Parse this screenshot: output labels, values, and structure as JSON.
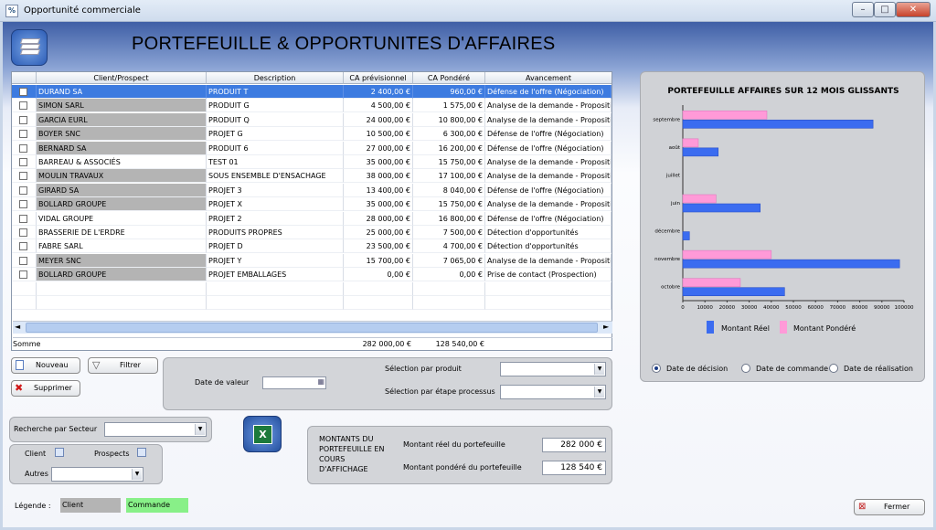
{
  "window": {
    "title": "Opportunité commerciale",
    "icon_text": "%",
    "min": "–",
    "max": "□",
    "close": "✕"
  },
  "page_title": "PORTEFEUILLE & OPPORTUNITES D'AFFAIRES",
  "grid": {
    "columns": [
      "Client/Prospect",
      "Description",
      "CA prévisionnel",
      "CA Pondéré",
      "Avancement"
    ],
    "rows": [
      {
        "client": "DURAND SA",
        "description": "PRODUIT T",
        "ca_prev": "2 400,00 €",
        "ca_pond": "960,00 €",
        "avancement": "Défense de l'offre (Négociation)"
      },
      {
        "client": "SIMON SARL",
        "description": "PRODUIT G",
        "ca_prev": "4 500,00 €",
        "ca_pond": "1 575,00 €",
        "avancement": "Analyse de la demande - Propositions"
      },
      {
        "client": "GARCIA EURL",
        "description": "PRODUIT Q",
        "ca_prev": "24 000,00 €",
        "ca_pond": "10 800,00 €",
        "avancement": "Analyse de la demande - Propositions"
      },
      {
        "client": "BOYER SNC",
        "description": "PROJET G",
        "ca_prev": "10 500,00 €",
        "ca_pond": "6 300,00 €",
        "avancement": "Défense de l'offre (Négociation)"
      },
      {
        "client": "BERNARD SA",
        "description": "PRODUIT 6",
        "ca_prev": "27 000,00 €",
        "ca_pond": "16 200,00 €",
        "avancement": "Défense de l'offre (Négociation)"
      },
      {
        "client": "BARREAU & ASSOCIÉS",
        "description": "TEST 01",
        "ca_prev": "35 000,00 €",
        "ca_pond": "15 750,00 €",
        "avancement": "Analyse de la demande - Propositions"
      },
      {
        "client": "MOULIN TRAVAUX",
        "description": "SOUS ENSEMBLE D'ENSACHAGE",
        "ca_prev": "38 000,00 €",
        "ca_pond": "17 100,00 €",
        "avancement": "Analyse de la demande - Propositions"
      },
      {
        "client": "GIRARD SA",
        "description": "PROJET 3",
        "ca_prev": "13 400,00 €",
        "ca_pond": "8 040,00 €",
        "avancement": "Défense de l'offre (Négociation)"
      },
      {
        "client": "BOLLARD GROUPE",
        "description": "PROJET X",
        "ca_prev": "35 000,00 €",
        "ca_pond": "15 750,00 €",
        "avancement": "Analyse de la demande - Propositions"
      },
      {
        "client": "VIDAL GROUPE",
        "description": "PROJET 2",
        "ca_prev": "28 000,00 €",
        "ca_pond": "16 800,00 €",
        "avancement": "Défense de l'offre (Négociation)"
      },
      {
        "client": "BRASSERIE DE L'ERDRE",
        "description": "PRODUITS PROPRES",
        "ca_prev": "25 000,00 €",
        "ca_pond": "7 500,00 €",
        "avancement": "Détection d'opportunités"
      },
      {
        "client": "FABRE SARL",
        "description": "PROJET D",
        "ca_prev": "23 500,00 €",
        "ca_pond": "4 700,00 €",
        "avancement": "Détection d'opportunités"
      },
      {
        "client": "MEYER SNC",
        "description": "PROJET Y",
        "ca_prev": "15 700,00 €",
        "ca_pond": "7 065,00 €",
        "avancement": "Analyse de la demande - Propositions"
      },
      {
        "client": "BOLLARD GROUPE",
        "description": "PROJET EMBALLAGES",
        "ca_prev": "0,00 €",
        "ca_pond": "0,00 €",
        "avancement": "Prise de contact (Prospection)"
      }
    ],
    "total_label": "Somme",
    "total_prev": "282 000,00 €",
    "total_pond": "128 540,00 €"
  },
  "buttons": {
    "nouveau": "Nouveau",
    "filtrer": "Filtrer",
    "supprimer": "Supprimer",
    "fermer": "Fermer"
  },
  "filters": {
    "date_valeur": "Date de valeur",
    "sel_produit": "Sélection par produit",
    "sel_etape": "Sélection par étape processus",
    "recherche_secteur": "Recherche par Secteur",
    "client": "Client",
    "prospects": "Prospects",
    "autres": "Autres"
  },
  "montants": {
    "title": "MONTANTS DU PORTEFEUILLE EN COURS D'AFFICHAGE",
    "reel_label": "Montant réel du portefeuille",
    "reel_value": "282 000 €",
    "pondere_label": "Montant pondéré du portefeuille",
    "pondere_value": "128 540 €"
  },
  "legend": {
    "label": "Légende :",
    "client": "Client",
    "commande": "Commande"
  },
  "radios": [
    {
      "label": "Date de décision",
      "checked": true
    },
    {
      "label": "Date de commande",
      "checked": false
    },
    {
      "label": "Date de réalisation",
      "checked": false
    }
  ],
  "colors": {
    "reel": "#3b6cf0",
    "pondere": "#ff9ad8",
    "selection": "#3d7be0",
    "client_gray": "#b4b4b4",
    "commande_green": "#88f088"
  },
  "chart_data": {
    "type": "bar",
    "orientation": "horizontal",
    "title": "PORTEFEUILLE AFFAIRES SUR 12 MOIS GLISSANTS",
    "categories": [
      "septembre",
      "août",
      "juillet",
      "juin",
      "décembre",
      "novembre",
      "octobre"
    ],
    "series": [
      {
        "name": "Montant Réel",
        "values": [
          86000,
          16000,
          0,
          35000,
          3000,
          98000,
          46000
        ]
      },
      {
        "name": "Montant Pondéré",
        "values": [
          38000,
          7000,
          0,
          15000,
          0,
          40000,
          26000
        ]
      }
    ],
    "xlim": [
      0,
      100000
    ],
    "xticks": [
      "0",
      "10000",
      "20000",
      "30000",
      "40000",
      "50000",
      "60000",
      "70000",
      "80000",
      "90000",
      "100000"
    ],
    "legend": "bottom"
  }
}
